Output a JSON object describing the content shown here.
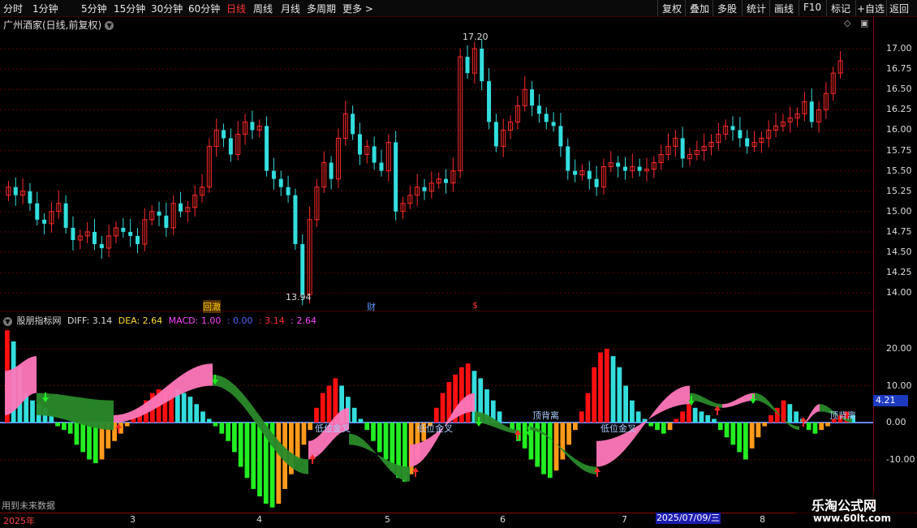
{
  "toolbar": {
    "left_items": [
      "分时",
      "1分钟",
      "5分钟",
      "15分钟",
      "30分钟",
      "60分钟",
      "日线",
      "周线",
      "月线",
      "多周期",
      "更多 >"
    ],
    "active_index": 6,
    "right_items": [
      "复权",
      "叠加",
      "多股",
      "统计",
      "画线",
      "F10",
      "标记",
      "+自选",
      "返回"
    ]
  },
  "main": {
    "title": "广州酒家(日线,前复权)",
    "high_label": "17.20",
    "low_label": "13.94",
    "y_ticks": [
      "17.00",
      "16.75",
      "16.50",
      "16.25",
      "16.00",
      "15.75",
      "15.50",
      "15.25",
      "15.00",
      "14.75",
      "14.50",
      "14.25",
      "14.00"
    ],
    "events": [
      {
        "label": "回澈",
        "color": "#ffcc00"
      },
      {
        "label": "财",
        "color": "#5599ff"
      },
      {
        "label": "$",
        "color": "#ff3333"
      }
    ]
  },
  "indicator": {
    "name": "股朋指标网",
    "diff": "DIFF: 3.14",
    "dea": "DEA: 2.64",
    "macd": "MACD: 1.00",
    "v1": ": 0.00",
    "v2": ": 3.14",
    "v3": ": 2.64",
    "y_ticks": [
      "20.00",
      "10.00",
      "0.00",
      "-10.00"
    ],
    "current_value": "4.21",
    "annotations": [
      "低位金叉",
      "低位金叉",
      "顶背离",
      "低位金叉",
      "顶背离"
    ],
    "note": "用到未来数据"
  },
  "xaxis": {
    "labels": [
      "2025年",
      "3",
      "4",
      "5",
      "6",
      "7",
      "8"
    ],
    "selected_date": "2025/07/09/三"
  },
  "watermark": {
    "line1": "乐淘公式网",
    "line2": "www.60lt.com"
  },
  "colors": {
    "up": "#ff2a2a",
    "down": "#33dddd",
    "macd_pos": "#ff1010",
    "macd_neg": "#22ee22",
    "ribbon_up": "#ff77bb",
    "ribbon_down": "#2a8a2a"
  }
}
